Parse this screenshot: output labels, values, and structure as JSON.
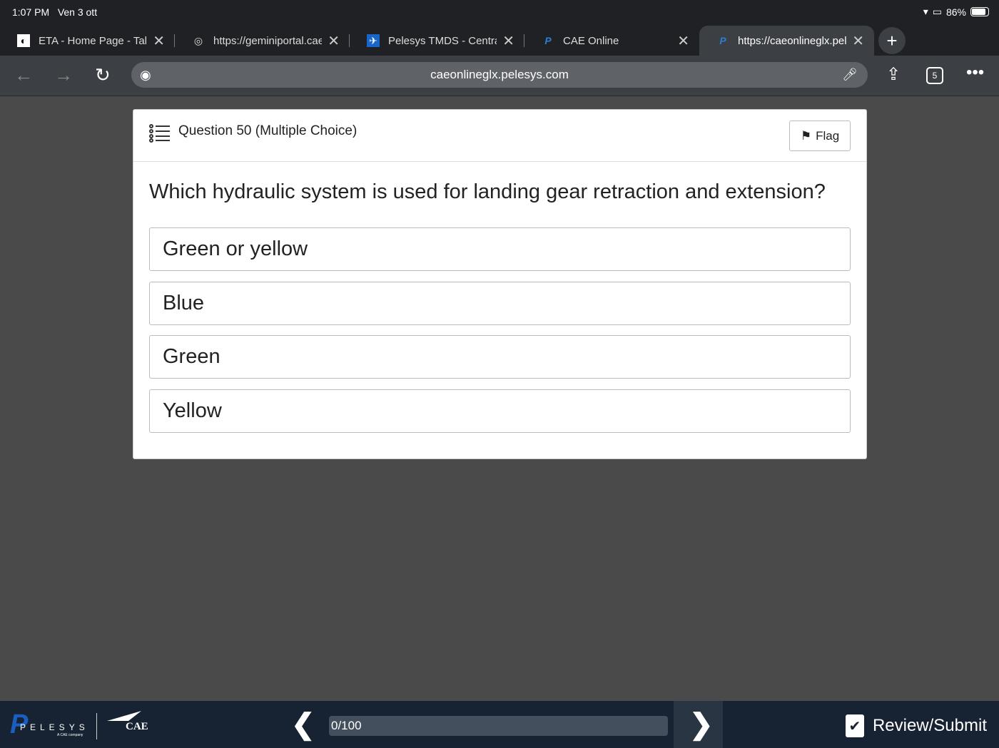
{
  "status": {
    "time": "1:07 PM",
    "date": "Ven 3 ott",
    "battery": "86%"
  },
  "tabs": [
    {
      "title": "ETA - Home Page - Talon",
      "icon": "talon-icon"
    },
    {
      "title": "https://geminiportal.cae",
      "icon": "globe-icon"
    },
    {
      "title": "Pelesys TMDS - Central",
      "icon": "plane-icon"
    },
    {
      "title": "CAE Online",
      "icon": "pelesys-icon"
    },
    {
      "title": "https://caeonlineglx.pelesys",
      "icon": "pelesys-icon",
      "active": true
    }
  ],
  "toolbar": {
    "url": "caeonlineglx.pelesys.com",
    "tab_count": "5"
  },
  "question": {
    "header": "Question 50 (Multiple Choice)",
    "flag_label": "Flag",
    "text": "Which hydraulic system is used for landing gear retraction and extension?",
    "options": [
      "Green or yellow",
      "Blue",
      "Green",
      "Yellow"
    ]
  },
  "footer": {
    "brand": "PELESYS",
    "brand_sub": "A CAE company",
    "cae": "CAE",
    "progress_text": "0/100",
    "progress": 0,
    "review_label": "Review/Submit"
  }
}
